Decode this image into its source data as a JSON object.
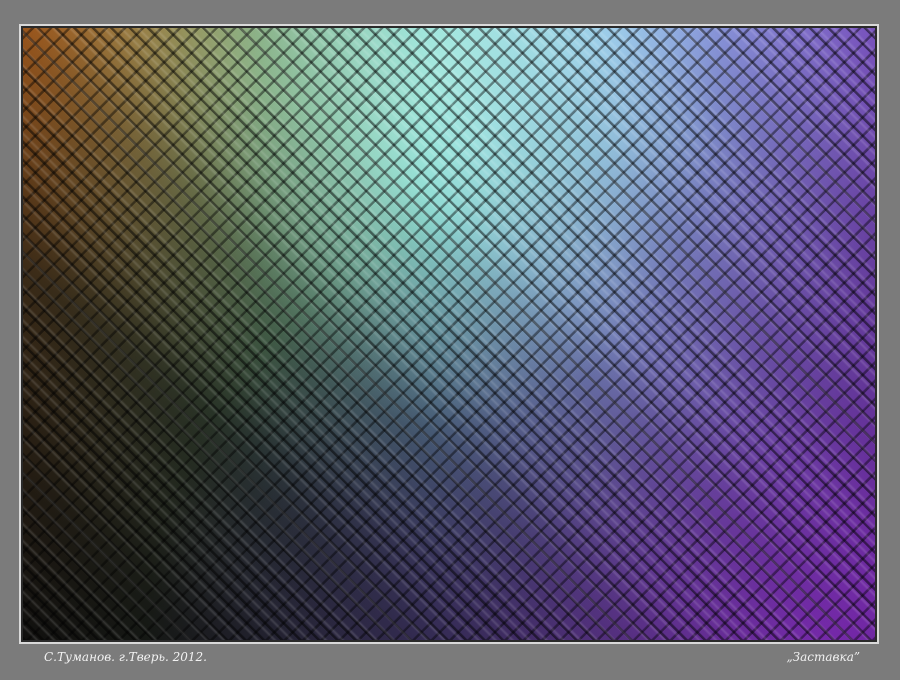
{
  "photo": {
    "colors": {
      "orange": "#c86a1e",
      "cyan": "#79d6d0",
      "violet": "#8a5ed8",
      "dark": "#0a1414",
      "background": "#7b7b7b",
      "frame": "#d9d9d9"
    }
  },
  "caption": {
    "author": "С.Туманов. г.Тверь. 2012.",
    "title": "„Заставка”"
  }
}
